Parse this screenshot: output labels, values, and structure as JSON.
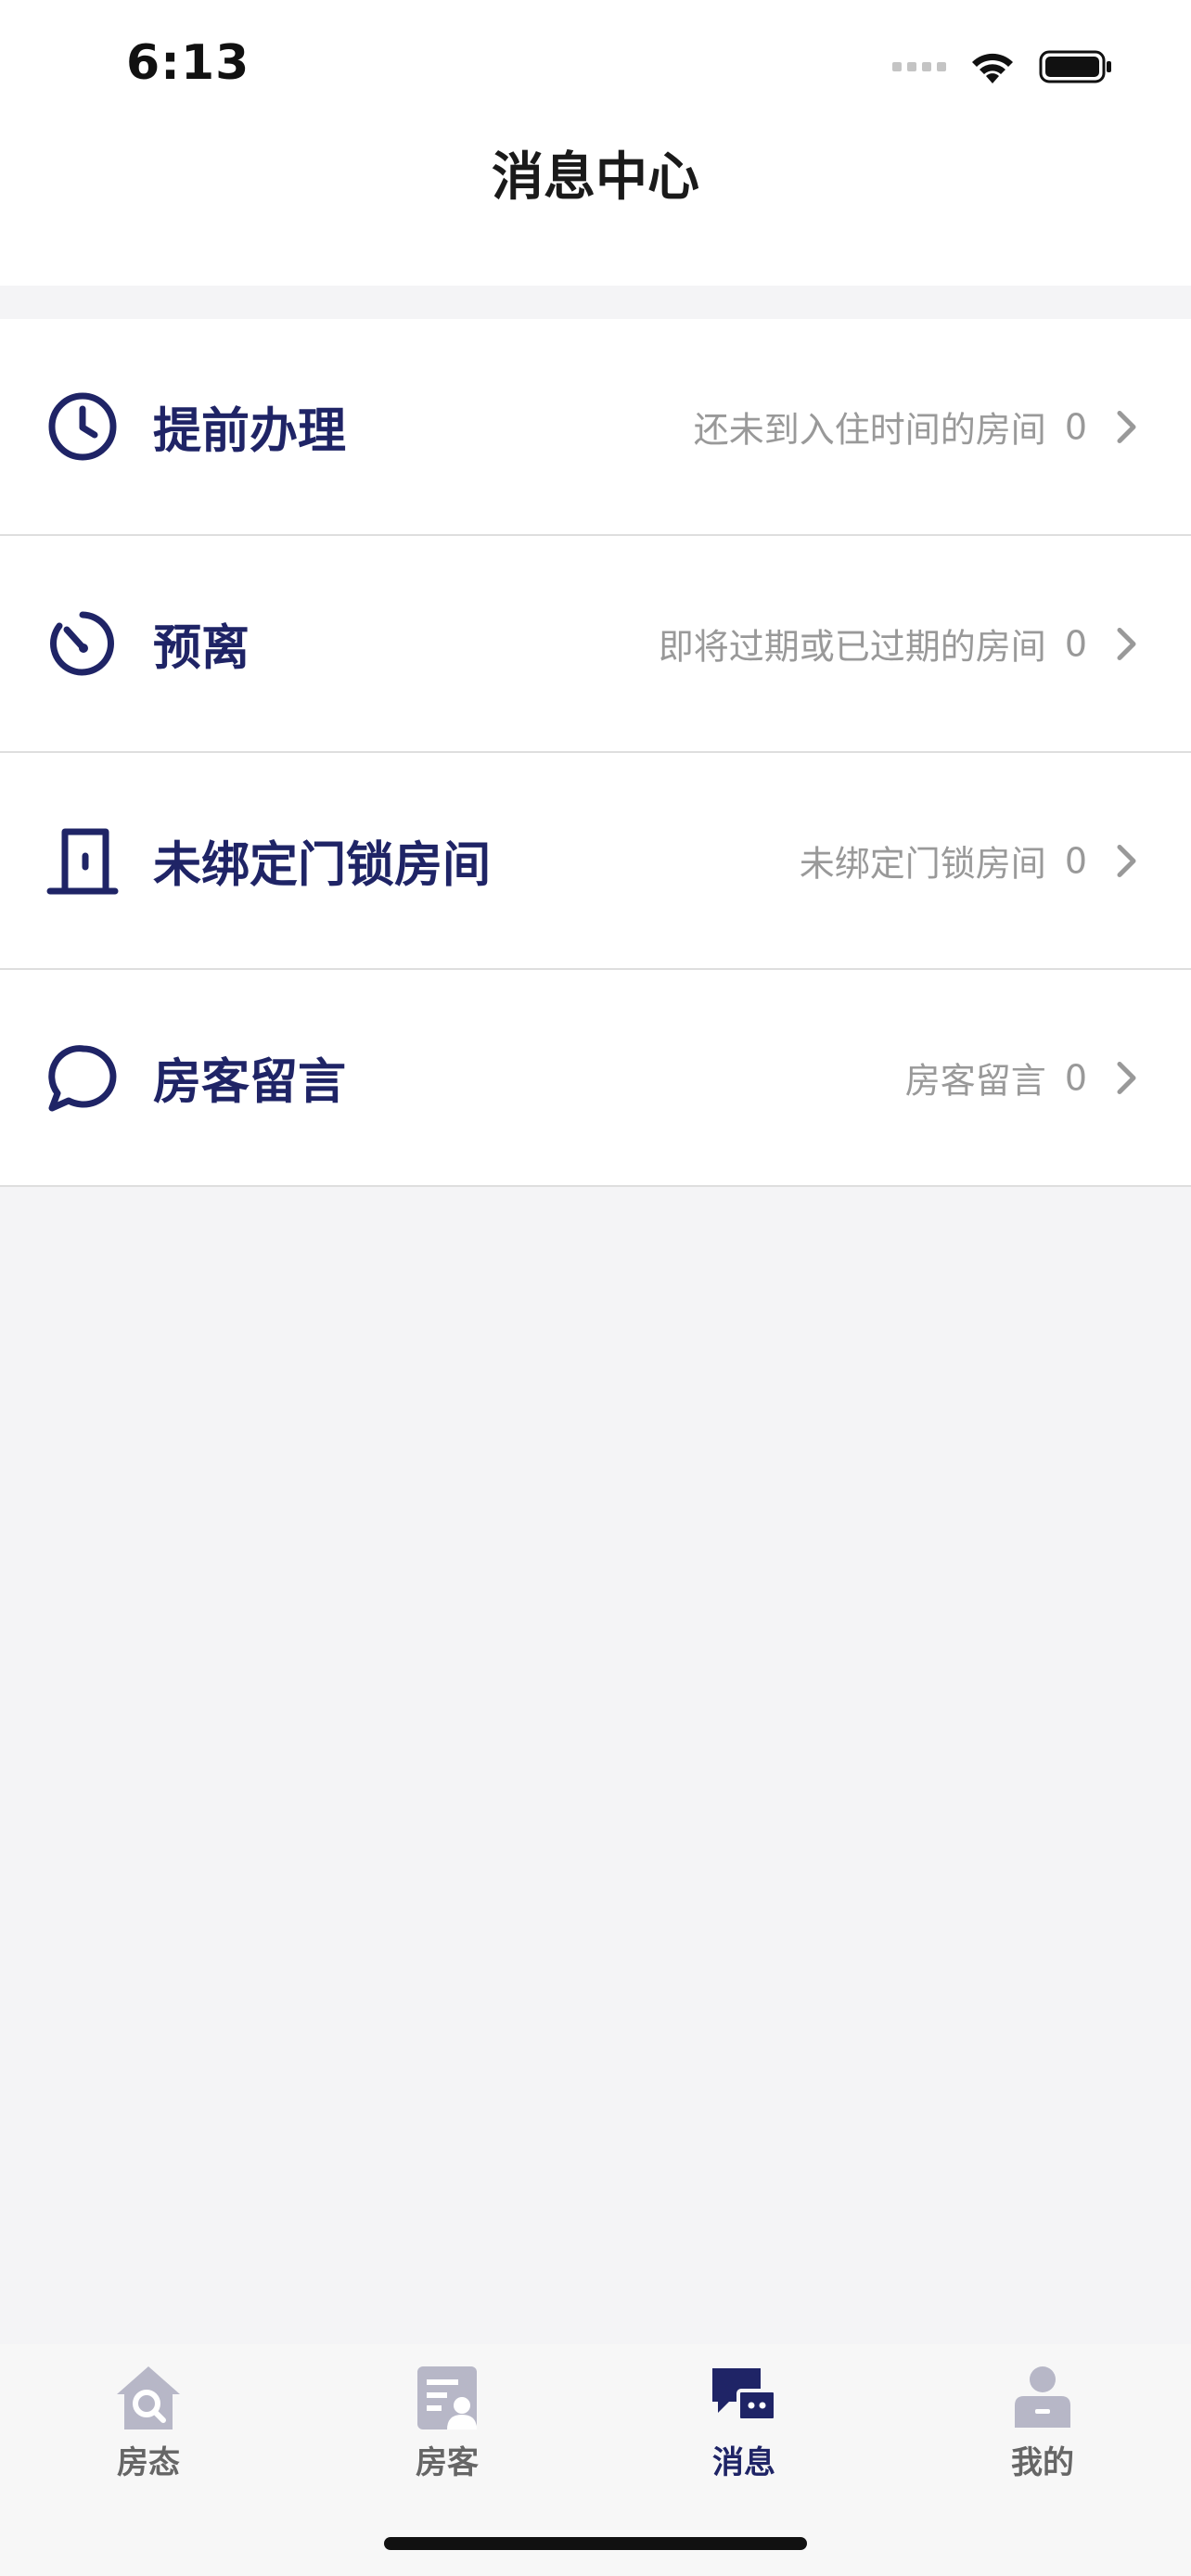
{
  "status_bar": {
    "time": "6:13"
  },
  "header": {
    "title": "消息中心"
  },
  "menu": [
    {
      "label": "提前办理",
      "description": "还未到入住时间的房间",
      "count": "0",
      "icon": "clock-icon"
    },
    {
      "label": "预离",
      "description": "即将过期或已过期的房间",
      "count": "0",
      "icon": "timer-icon"
    },
    {
      "label": "未绑定门锁房间",
      "description": "未绑定门锁房间",
      "count": "0",
      "icon": "door-icon"
    },
    {
      "label": "房客留言",
      "description": "房客留言",
      "count": "0",
      "icon": "chat-bubble-icon"
    }
  ],
  "tab_bar": {
    "active": "消息",
    "tabs": [
      {
        "label": "房态",
        "icon": "house-search-icon"
      },
      {
        "label": "房客",
        "icon": "guest-card-icon"
      },
      {
        "label": "消息",
        "icon": "message-icon"
      },
      {
        "label": "我的",
        "icon": "profile-icon"
      }
    ]
  },
  "colors": {
    "accent": "#1f2466",
    "inactive_tab": "#b7b7c7",
    "muted_text": "#999999",
    "background": "#f4f4f6"
  }
}
